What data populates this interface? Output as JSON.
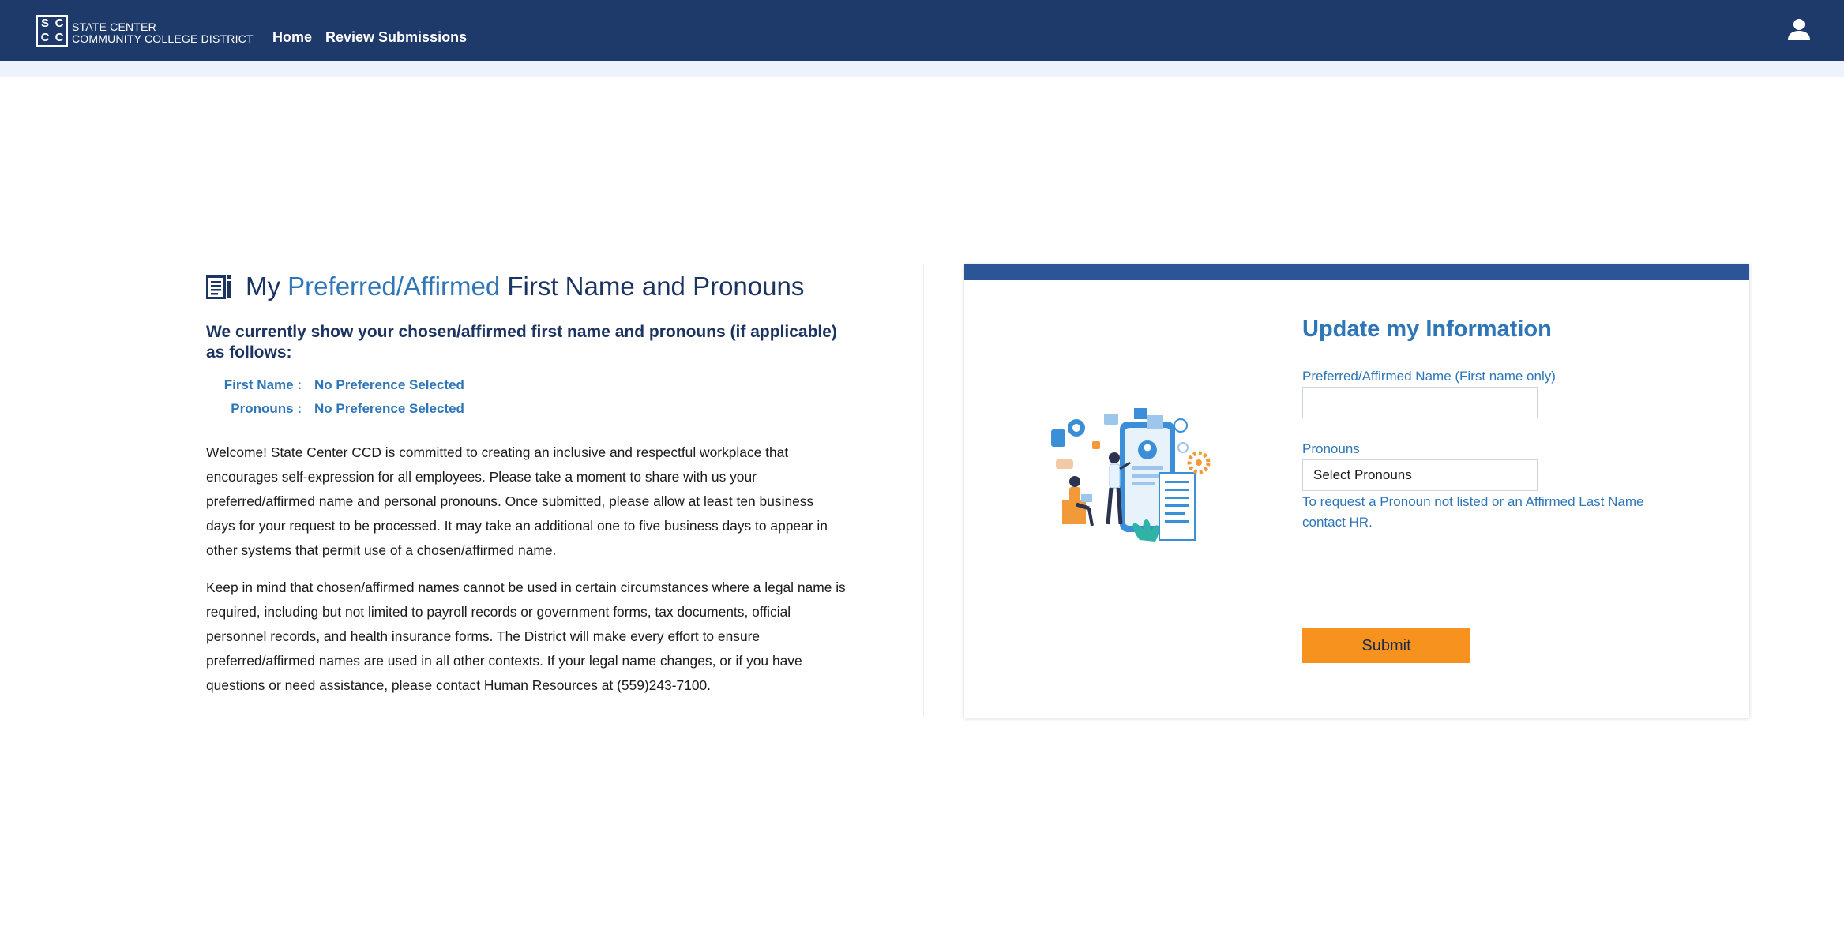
{
  "header": {
    "logo_letters": [
      "S",
      "C",
      "C",
      "C"
    ],
    "logo_line1": "STATE CENTER",
    "logo_line2": "COMMUNITY COLLEGE DISTRICT",
    "nav": [
      {
        "label": "Home"
      },
      {
        "label": "Review Submissions"
      }
    ],
    "user_icon": "user-icon",
    "colors": {
      "navbar": "#1e3a6b",
      "subbar": "#eef3fb"
    }
  },
  "main": {
    "heading_icon": "document-list-icon",
    "title_prefix": "My",
    "title_highlight": "Preferred/Affirmed",
    "title_suffix": "First Name and Pronouns",
    "subheading": "We currently show your chosen/affirmed first name and pronouns (if applicable) as follows:",
    "first_name_label": "First Name :",
    "first_name_value": "No Preference Selected",
    "pronouns_label": "Pronouns :",
    "pronouns_value": "No Preference Selected",
    "paragraph1": "Welcome! State Center CCD is committed to creating an inclusive and respectful workplace that encourages self-expression for all employees. Please take a moment to share with us your preferred/affirmed name and personal pronouns. Once submitted, please allow at least ten business days for your request to be processed. It may take an additional one to five business days to appear in other systems that permit use of a chosen/affirmed name.",
    "paragraph2": "Keep in mind that chosen/affirmed names cannot be used in certain circumstances where a legal name is required, including but not limited to payroll records or government forms, tax documents, official personnel records, and health insurance forms. The District will make every effort to ensure preferred/affirmed names are used in all other contexts. If your legal name changes, or if you have questions or need assistance, please contact Human Resources at (559)243-7100."
  },
  "form": {
    "title": "Update my Information",
    "name_label": "Preferred/Affirmed Name (First name only)",
    "name_value": "",
    "pronouns_label": "Pronouns",
    "pronouns_selected": "Select Pronouns",
    "hint": "To request a Pronoun not listed or an Affirmed Last Name contact HR.",
    "submit_label": "Submit",
    "illustration": "people-with-phone-illustration",
    "colors": {
      "accent": "#2e76b8",
      "card_bar": "#2b5597",
      "submit": "#f7921e"
    }
  }
}
